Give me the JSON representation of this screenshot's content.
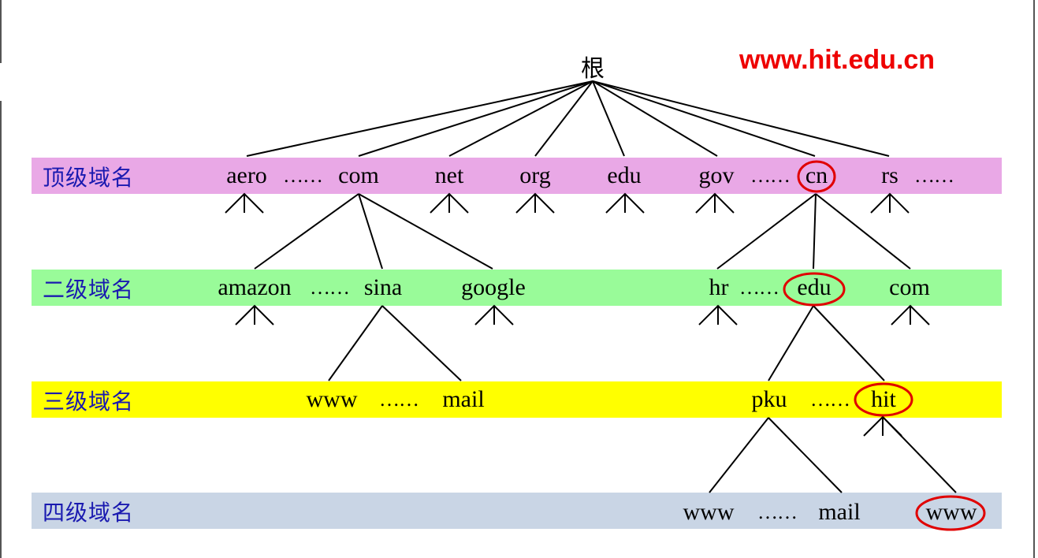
{
  "title": {
    "root": "根",
    "url": "www.hit.edu.cn"
  },
  "colors": {
    "top_band": "#e9a8e6",
    "second_band": "#99fb99",
    "third_band": "#ffff00",
    "fourth_band": "#c9d5e5",
    "label_text": "#1a1ab0",
    "highlight": "#e00000"
  },
  "levels": [
    {
      "label": "顶级域名",
      "nodes": [
        "aero",
        "com",
        "net",
        "org",
        "edu",
        "gov",
        "cn",
        "rs"
      ],
      "ellipses": [
        "……",
        "……",
        "……"
      ]
    },
    {
      "label": "二级域名",
      "nodes": [
        "amazon",
        "sina",
        "google",
        "hr",
        "edu",
        "com"
      ],
      "ellipses": [
        "……",
        "……"
      ]
    },
    {
      "label": "三级域名",
      "nodes": [
        "www",
        "mail",
        "pku",
        "hit"
      ],
      "ellipses": [
        "……",
        "……"
      ]
    },
    {
      "label": "四级域名",
      "nodes": [
        "www",
        "mail",
        "www"
      ],
      "ellipses": [
        "……"
      ]
    }
  ],
  "highlighted_path": [
    "cn",
    "edu",
    "hit",
    "www"
  ]
}
